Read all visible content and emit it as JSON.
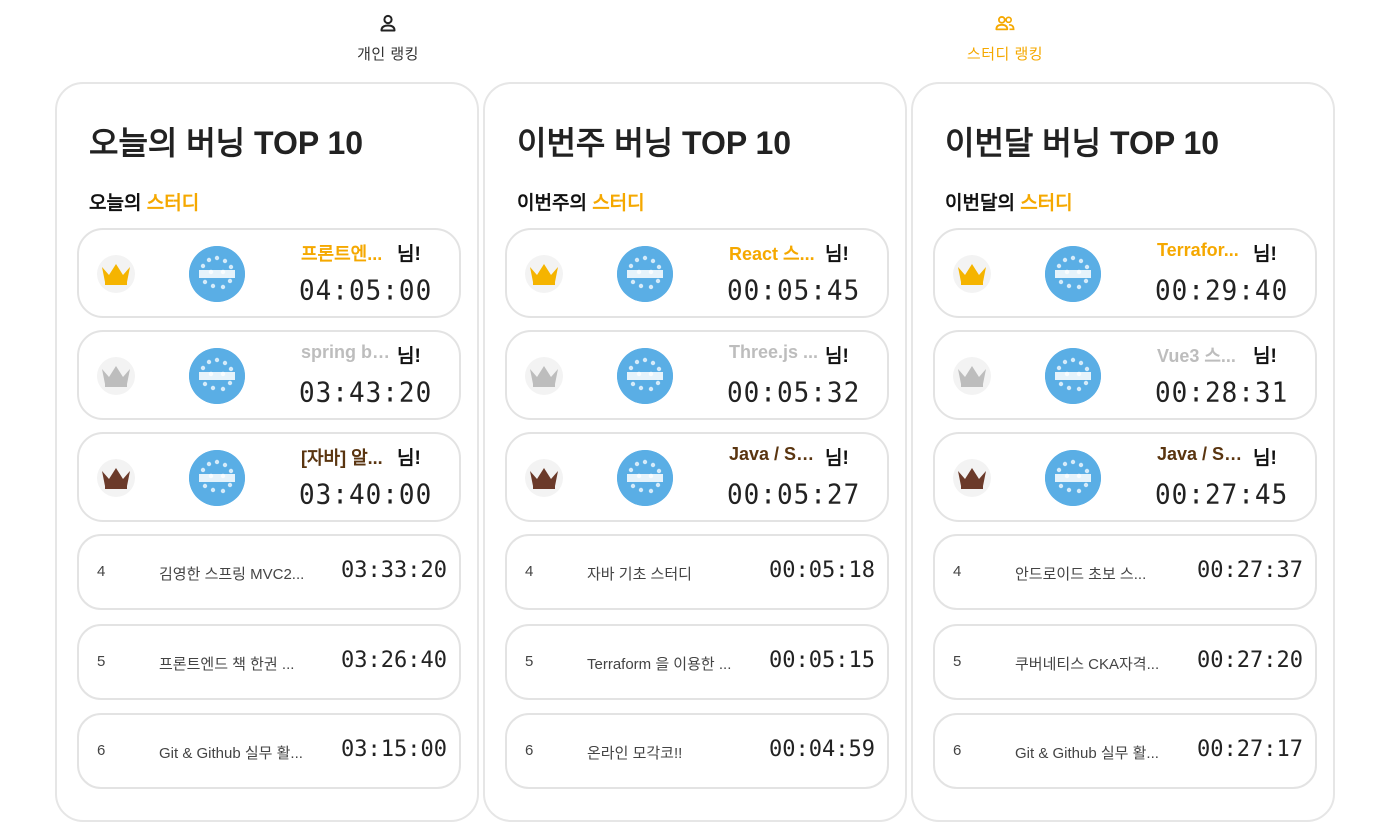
{
  "tabs": [
    {
      "label": "개인 랭킹",
      "icon": "person-icon",
      "active": false
    },
    {
      "label": "스터디 랭킹",
      "icon": "group-icon",
      "active": true
    }
  ],
  "colors": {
    "accent": "#f5a800",
    "gold": "#f5b400",
    "silver": "#bdbdbd",
    "bronze": "#6b3a2a",
    "gold_name": "#f5a800",
    "silver_name": "#bdbdbd",
    "bronze_name": "#5a3510"
  },
  "panels": [
    {
      "title": "오늘의 버닝 TOP 10",
      "subtitle_prefix": "오늘의",
      "subtitle_accent": "스터디",
      "top": [
        {
          "name": "프론트엔...",
          "honorific": "님!",
          "time": "04:05:00",
          "medal": "gold-crown-icon"
        },
        {
          "name": "spring bo...",
          "honorific": "님!",
          "time": "03:43:20",
          "medal": "silver-crown-icon"
        },
        {
          "name": "[자바] 알...",
          "honorific": "님!",
          "time": "03:40:00",
          "medal": "bronze-crown-icon"
        }
      ],
      "rows": [
        {
          "rank": "4",
          "name": "김영한 스프링 MVC2...",
          "time": "03:33:20"
        },
        {
          "rank": "5",
          "name": "프론트엔드 책 한권 ...",
          "time": "03:26:40"
        },
        {
          "rank": "6",
          "name": "Git & Github 실무 활...",
          "time": "03:15:00"
        }
      ]
    },
    {
      "title": "이번주 버닝 TOP 10",
      "subtitle_prefix": "이번주의",
      "subtitle_accent": "스터디",
      "top": [
        {
          "name": "React 스...",
          "honorific": "님!",
          "time": "00:05:45",
          "medal": "gold-crown-icon"
        },
        {
          "name": "Three.js ...",
          "honorific": "님!",
          "time": "00:05:32",
          "medal": "silver-crown-icon"
        },
        {
          "name": "Java / Sp...",
          "honorific": "님!",
          "time": "00:05:27",
          "medal": "bronze-crown-icon"
        }
      ],
      "rows": [
        {
          "rank": "4",
          "name": "자바 기초 스터디",
          "time": "00:05:18"
        },
        {
          "rank": "5",
          "name": "Terraform 을 이용한 ...",
          "time": "00:05:15"
        },
        {
          "rank": "6",
          "name": "온라인 모각코!!",
          "time": "00:04:59"
        }
      ]
    },
    {
      "title": "이번달 버닝 TOP 10",
      "subtitle_prefix": "이번달의",
      "subtitle_accent": "스터디",
      "top": [
        {
          "name": "Terrafor...",
          "honorific": "님!",
          "time": "00:29:40",
          "medal": "gold-crown-icon"
        },
        {
          "name": "Vue3 스...",
          "honorific": "님!",
          "time": "00:28:31",
          "medal": "silver-crown-icon"
        },
        {
          "name": "Java / Sp...",
          "honorific": "님!",
          "time": "00:27:45",
          "medal": "bronze-crown-icon"
        }
      ],
      "rows": [
        {
          "rank": "4",
          "name": "안드로이드 초보 스...",
          "time": "00:27:37"
        },
        {
          "rank": "5",
          "name": "쿠버네티스 CKA자격...",
          "time": "00:27:20"
        },
        {
          "rank": "6",
          "name": "Git & Github 실무 활...",
          "time": "00:27:17"
        }
      ]
    }
  ]
}
